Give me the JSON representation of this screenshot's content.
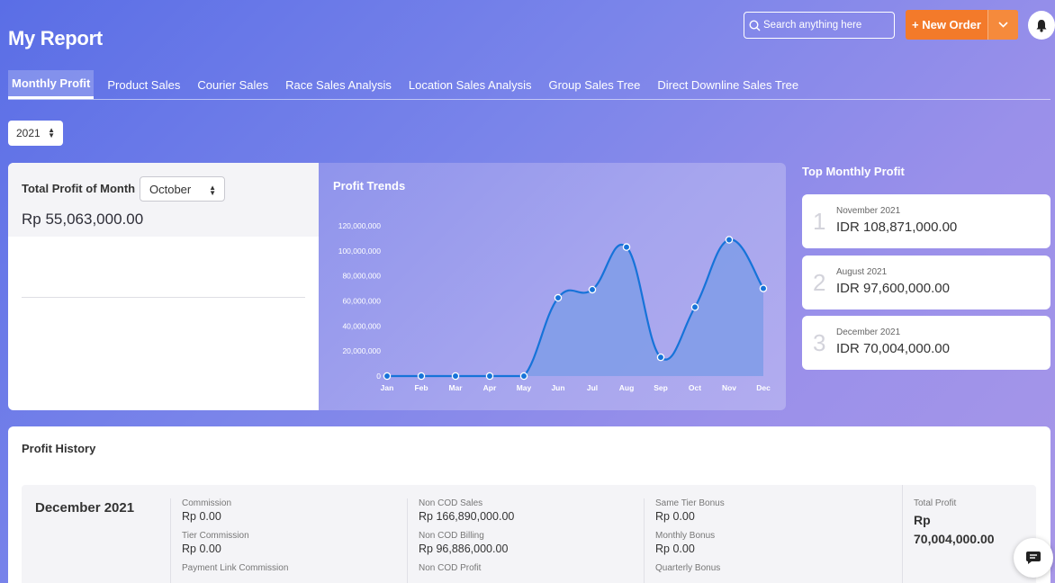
{
  "header": {
    "title": "My Report",
    "search_placeholder": "Search anything here",
    "new_order_label": "+ New Order"
  },
  "tabs": [
    {
      "label": "Monthly Profit",
      "active": true
    },
    {
      "label": "Product Sales"
    },
    {
      "label": "Courier Sales"
    },
    {
      "label": "Race Sales Analysis"
    },
    {
      "label": "Location Sales Analysis"
    },
    {
      "label": "Group Sales Tree"
    },
    {
      "label": "Direct Downline Sales Tree"
    }
  ],
  "year_filter": {
    "value": "2021"
  },
  "total_profit": {
    "label": "Total Profit of Month",
    "month": "October",
    "amount": "Rp 55,063,000.00"
  },
  "chart_data": {
    "type": "area",
    "title": "Profit Trends",
    "categories": [
      "Jan",
      "Feb",
      "Mar",
      "Apr",
      "May",
      "Jun",
      "Jul",
      "Aug",
      "Sep",
      "Oct",
      "Nov",
      "Dec"
    ],
    "values": [
      0,
      0,
      0,
      0,
      0,
      62500000,
      69000000,
      103000000,
      15000000,
      55063000,
      108871000,
      70004000
    ],
    "y_ticks": [
      0,
      20000000,
      40000000,
      60000000,
      80000000,
      100000000,
      120000000
    ],
    "y_tick_labels": [
      "0",
      "20,000,000",
      "40,000,000",
      "60,000,000",
      "80,000,000",
      "100,000,000",
      "120,000,000"
    ],
    "ylim": [
      0,
      120000000
    ],
    "grid": false,
    "colors": {
      "line": "#1673d9",
      "fill": "#7f9ce8",
      "marker": "#1673d9"
    }
  },
  "top_monthly": {
    "title": "Top Monthly Profit",
    "items": [
      {
        "rank": "1",
        "month": "November 2021",
        "value": "IDR 108,871,000.00"
      },
      {
        "rank": "2",
        "month": "August 2021",
        "value": "IDR 97,600,000.00"
      },
      {
        "rank": "3",
        "month": "December 2021",
        "value": "IDR 70,004,000.00"
      }
    ]
  },
  "profit_history": {
    "title": "Profit History",
    "rows": [
      {
        "period": "December 2021",
        "col1": [
          {
            "label": "Commission",
            "value": "Rp 0.00"
          },
          {
            "label": "Tier Commission",
            "value": "Rp 0.00"
          },
          {
            "label": "Payment Link Commission",
            "value": ""
          }
        ],
        "col2": [
          {
            "label": "Non COD Sales",
            "value": "Rp 166,890,000.00"
          },
          {
            "label": "Non COD Billing",
            "value": "Rp 96,886,000.00"
          },
          {
            "label": "Non COD Profit",
            "value": ""
          }
        ],
        "col3": [
          {
            "label": "Same Tier Bonus",
            "value": "Rp 0.00"
          },
          {
            "label": "Monthly Bonus",
            "value": "Rp 0.00"
          },
          {
            "label": "Quarterly Bonus",
            "value": ""
          }
        ],
        "total": {
          "label": "Total Profit",
          "currency": "Rp",
          "value": "70,004,000.00"
        }
      }
    ]
  },
  "colors": {
    "accent": "#f37a2a",
    "header_gradient_start": "#5a6ee6"
  }
}
